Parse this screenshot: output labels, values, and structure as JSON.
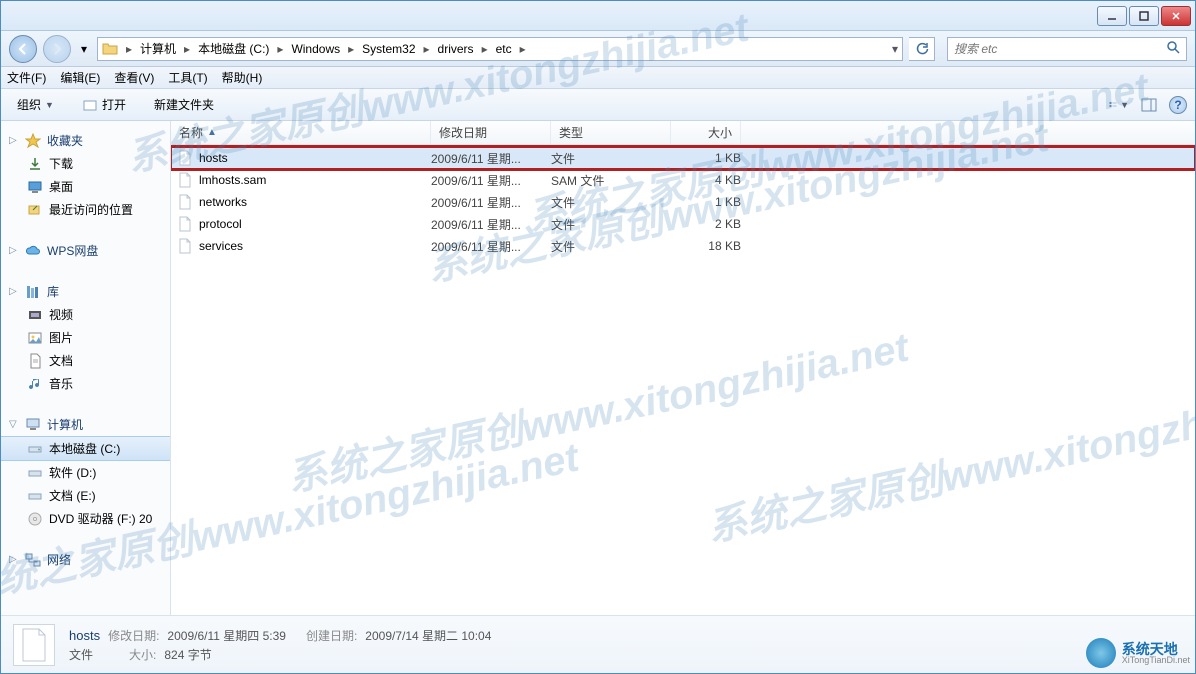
{
  "breadcrumbs": [
    "计算机",
    "本地磁盘 (C:)",
    "Windows",
    "System32",
    "drivers",
    "etc"
  ],
  "search": {
    "placeholder": "搜索 etc"
  },
  "menubar": [
    "文件(F)",
    "编辑(E)",
    "查看(V)",
    "工具(T)",
    "帮助(H)"
  ],
  "toolbar": {
    "organize": "组织",
    "open": "打开",
    "newfolder": "新建文件夹"
  },
  "sidebar": {
    "favorites": {
      "header": "收藏夹",
      "items": [
        "下载",
        "桌面",
        "最近访问的位置"
      ]
    },
    "wps": {
      "header": "WPS网盘"
    },
    "libraries": {
      "header": "库",
      "items": [
        "视频",
        "图片",
        "文档",
        "音乐"
      ]
    },
    "computer": {
      "header": "计算机",
      "items": [
        "本地磁盘 (C:)",
        "软件 (D:)",
        "文档 (E:)",
        "DVD 驱动器 (F:) 20"
      ]
    },
    "network": {
      "header": "网络"
    }
  },
  "columns": {
    "name": "名称",
    "date": "修改日期",
    "type": "类型",
    "size": "大小"
  },
  "files": [
    {
      "name": "hosts",
      "date": "2009/6/11 星期...",
      "type": "文件",
      "size": "1 KB",
      "selected": true,
      "highlighted": true
    },
    {
      "name": "lmhosts.sam",
      "date": "2009/6/11 星期...",
      "type": "SAM 文件",
      "size": "4 KB",
      "selected": false,
      "highlighted": false
    },
    {
      "name": "networks",
      "date": "2009/6/11 星期...",
      "type": "文件",
      "size": "1 KB",
      "selected": false,
      "highlighted": false
    },
    {
      "name": "protocol",
      "date": "2009/6/11 星期...",
      "type": "文件",
      "size": "2 KB",
      "selected": false,
      "highlighted": false
    },
    {
      "name": "services",
      "date": "2009/6/11 星期...",
      "type": "文件",
      "size": "18 KB",
      "selected": false,
      "highlighted": false
    }
  ],
  "details": {
    "name": "hosts",
    "modified_label": "修改日期:",
    "modified": "2009/6/11 星期四 5:39",
    "created_label": "创建日期:",
    "created": "2009/7/14 星期二 10:04",
    "type": "文件",
    "size_label": "大小:",
    "size": "824 字节"
  },
  "badge": {
    "title": "系统天地",
    "sub": "XiTongTianDi.net"
  },
  "watermark": "系统之家原创www.xitongzhijia.net"
}
